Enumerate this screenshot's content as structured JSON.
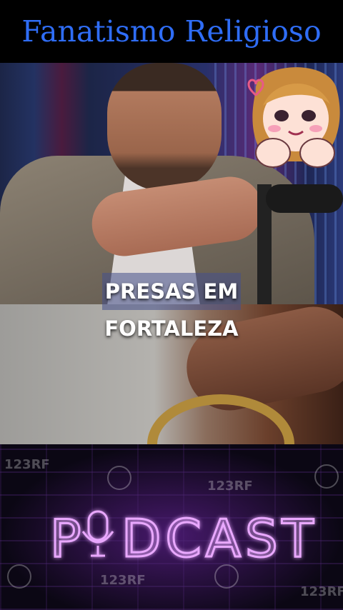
{
  "header": {
    "title": "Fanatismo Religioso"
  },
  "video": {
    "caption_line1": "PRESAS EM",
    "caption_line2": "FORTALEZA"
  },
  "branding": {
    "podcast_left": "P",
    "podcast_right": "DCAST",
    "watermark": "123RF"
  },
  "colors": {
    "title": "#2f6df6",
    "neon": "#e9a8ff",
    "panel_bg": "#0b0714"
  },
  "icons": [
    "microphone-icon",
    "camera-icon"
  ]
}
